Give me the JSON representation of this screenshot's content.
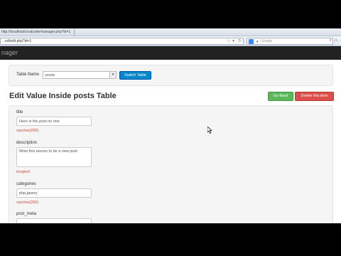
{
  "browser": {
    "title_url": "http://localhost/crudcode/manager.php?id=1",
    "address_url": "...ed/edit.php?id=1",
    "search_placeholder": "Google",
    "search_engine_icon": "google-icon"
  },
  "navbar": {
    "brand": "nager"
  },
  "table_selector": {
    "label": "Table Name",
    "selected": "posts",
    "button": "Switch Table"
  },
  "header": {
    "title": "Edit Value Inside posts Table",
    "go_back": "Go Back",
    "delete": "Delete this item"
  },
  "fields": [
    {
      "label": "title",
      "value": "Here is the post no one",
      "type": "varchar(200)"
    },
    {
      "label": "description",
      "value": "Wow this seems to be a new post",
      "type": "longtext"
    },
    {
      "label": "categories",
      "value": "php,jquery",
      "type": "varchar(200)"
    },
    {
      "label": "post_meta",
      "value": "",
      "type": ""
    }
  ],
  "colors": {
    "navbar_bg": "#222222",
    "primary_button": "#0088cc",
    "success_button": "#5bb75b",
    "danger_button": "#da4f49",
    "type_text": "#d14836"
  }
}
